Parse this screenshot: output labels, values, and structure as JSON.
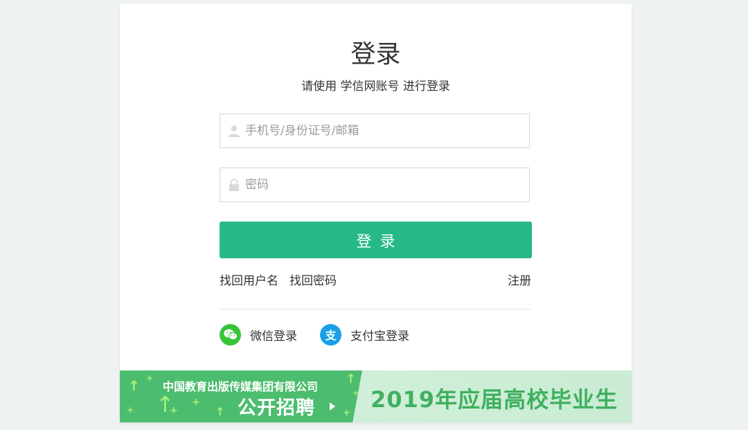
{
  "login": {
    "title": "登录",
    "subtitle": "请使用 学信网账号 进行登录",
    "username_placeholder": "手机号/身份证号/邮箱",
    "password_placeholder": "密码",
    "submit_label": "登录"
  },
  "links": {
    "recover_username": "找回用户名",
    "recover_password": "找回密码",
    "register": "注册"
  },
  "social": {
    "wechat_label": "微信登录",
    "alipay_label": "支付宝登录",
    "alipay_glyph": "支"
  },
  "banner": {
    "company": "中国教育出版传媒集团有限公司",
    "recruit": "公开招聘",
    "graduates": "2019年应届高校毕业生"
  },
  "colors": {
    "primary_button": "#26b985",
    "wechat": "#37c43a",
    "alipay": "#1aa0e8",
    "banner_green": "#4cbd6e"
  },
  "icons": {
    "username": "user-icon",
    "password": "lock-icon",
    "wechat": "wechat-icon",
    "alipay": "alipay-icon",
    "banner_arrow": "play-arrow-icon"
  }
}
